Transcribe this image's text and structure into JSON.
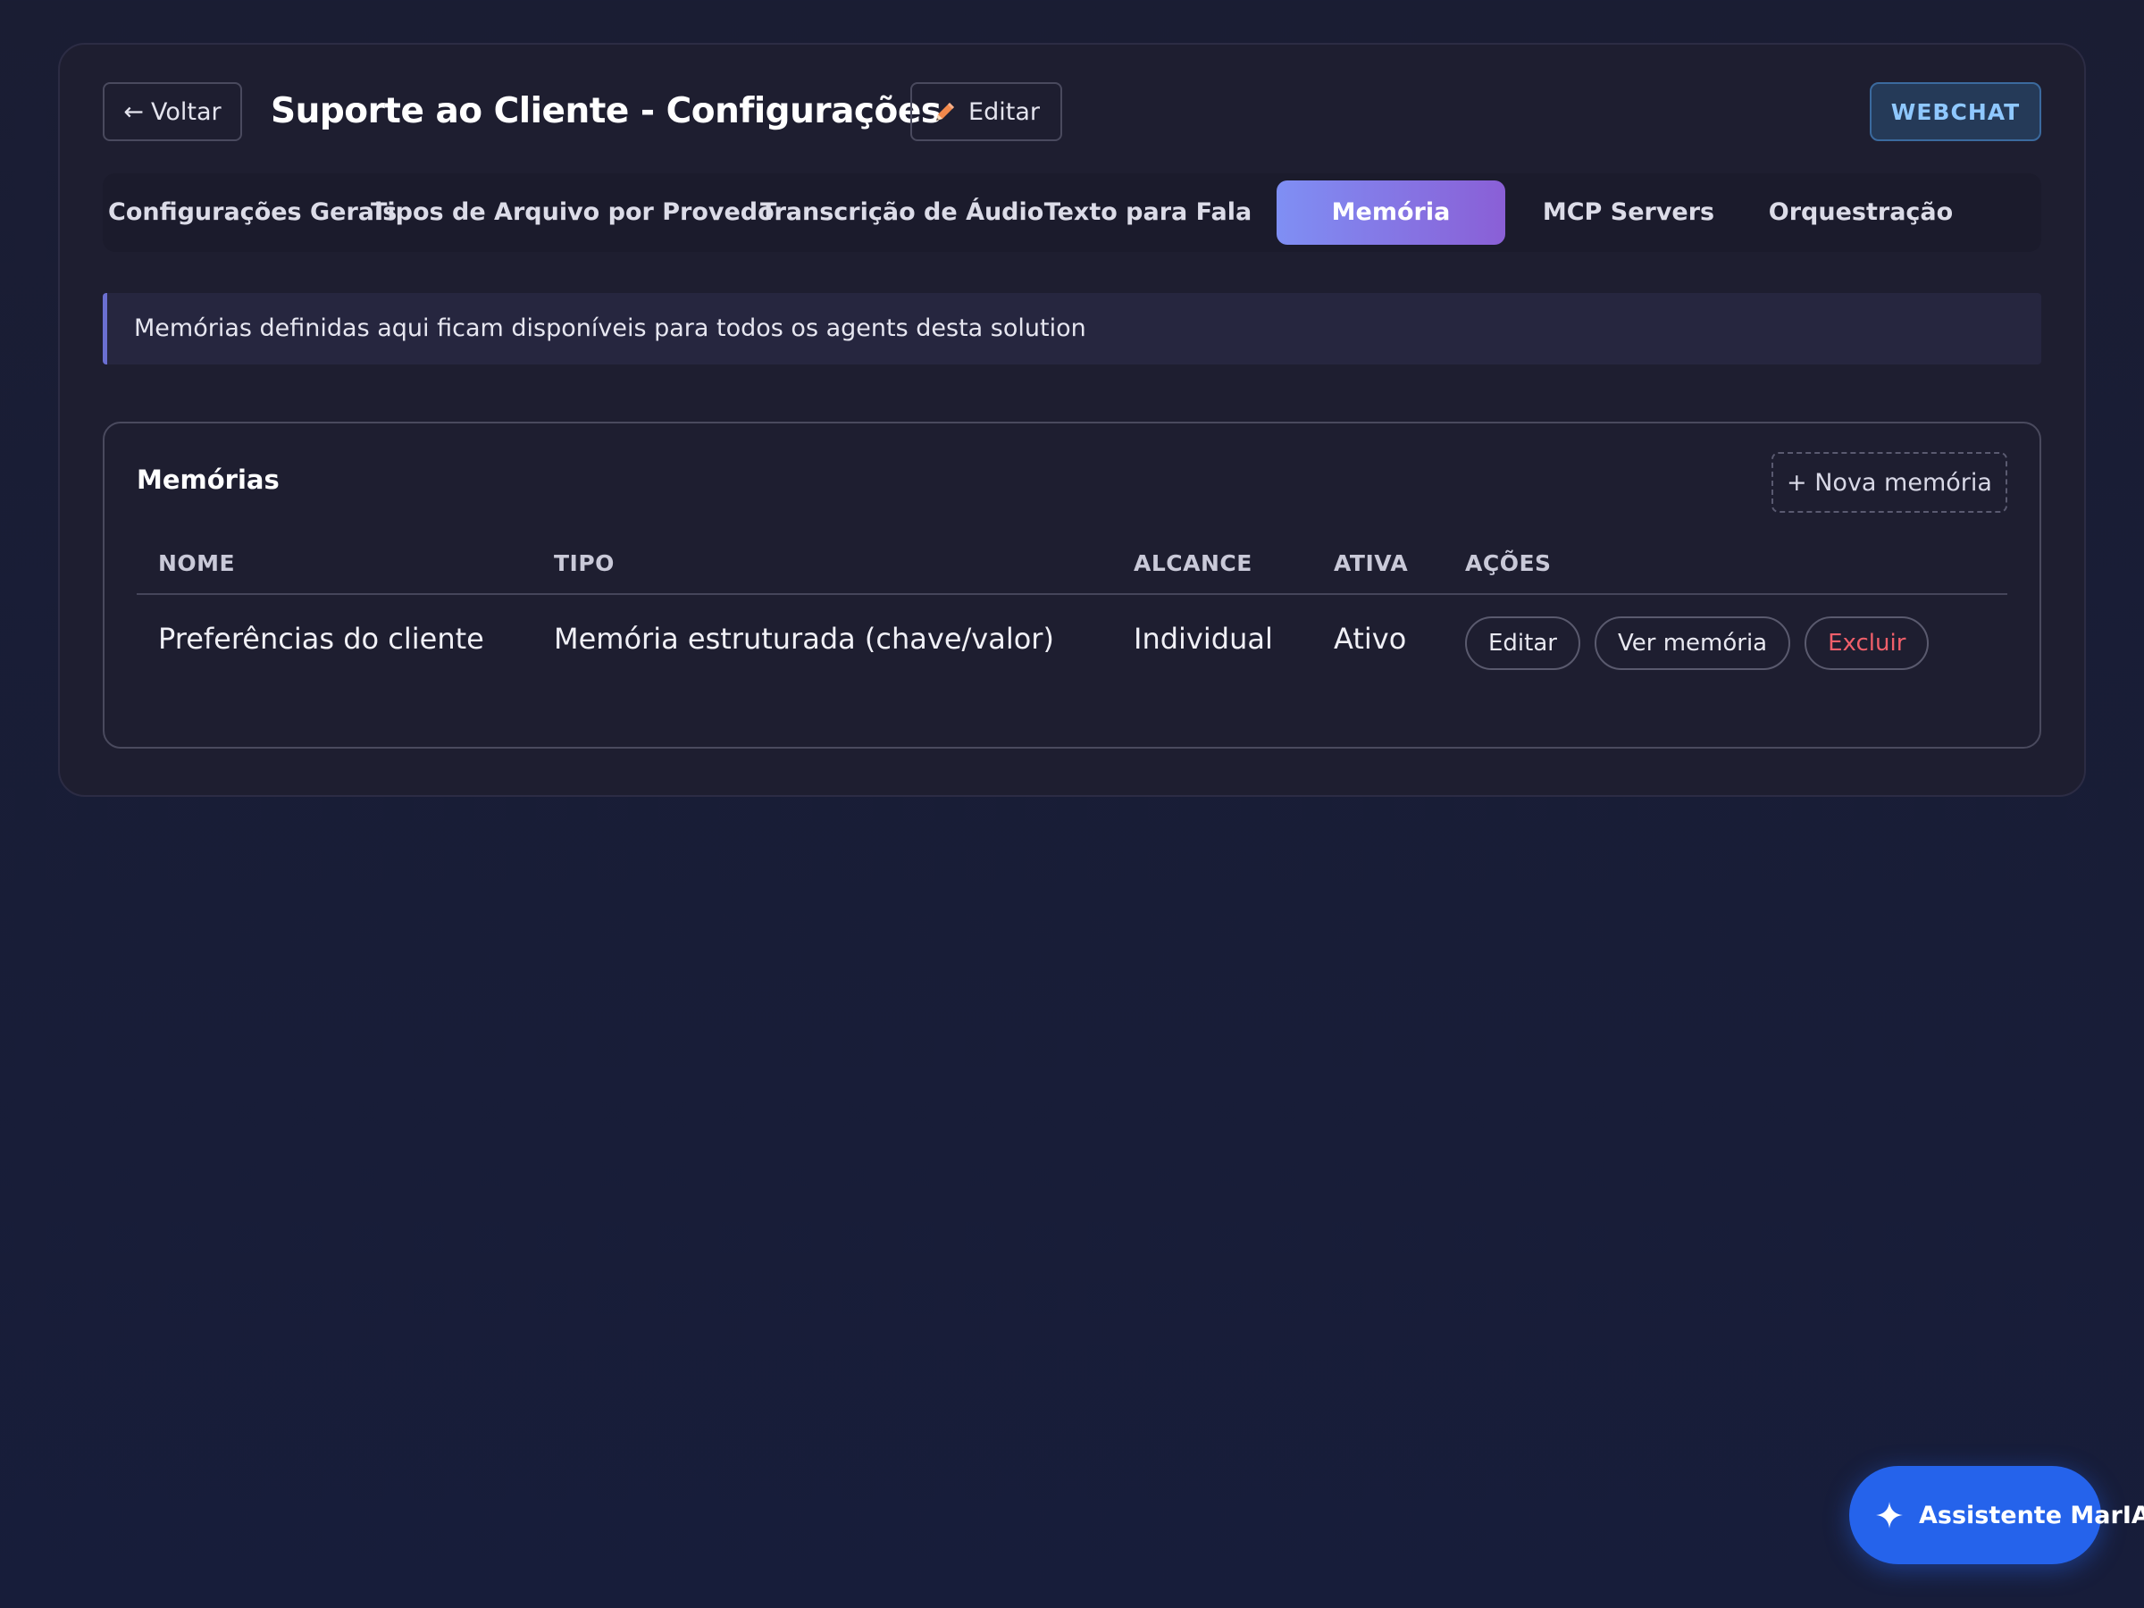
{
  "header": {
    "back_label": "Voltar",
    "back_arrow": "←",
    "title": "Suporte ao Cliente - Configurações",
    "edit_label": "Editar",
    "badge": "WEBCHAT"
  },
  "tabs": [
    {
      "label": "Configurações Gerais",
      "active": false
    },
    {
      "label": "Tipos de Arquivo por Provedor",
      "active": false
    },
    {
      "label": "Transcrição de Áudio",
      "active": false
    },
    {
      "label": "Texto para Fala",
      "active": false
    },
    {
      "label": "Memória",
      "active": true
    },
    {
      "label": "MCP Servers",
      "active": false
    },
    {
      "label": "Orquestração",
      "active": false
    }
  ],
  "info_banner": "Memórias definidas aqui ficam disponíveis para todos os agents desta solution",
  "memories": {
    "title": "Memórias",
    "new_button": "+ Nova memória",
    "columns": [
      "NOME",
      "TIPO",
      "ALCANCE",
      "ATIVA",
      "AÇÕES"
    ],
    "rows": [
      {
        "name": "Preferências do cliente",
        "type": "Memória estruturada (chave/valor)",
        "scope": "Individual",
        "active": "Ativo",
        "actions": {
          "edit": "Editar",
          "view": "Ver memória",
          "delete": "Excluir"
        }
      }
    ]
  },
  "assistant": {
    "label": "Assistente MarIA",
    "icon": "sparkle-icon"
  },
  "colors": {
    "active_tab_start": "#7f8ff4",
    "active_tab_end": "#8a5fd6",
    "badge_text": "#8fc8ff",
    "danger": "#f05f6a",
    "assistant_button": "#2563eb"
  }
}
